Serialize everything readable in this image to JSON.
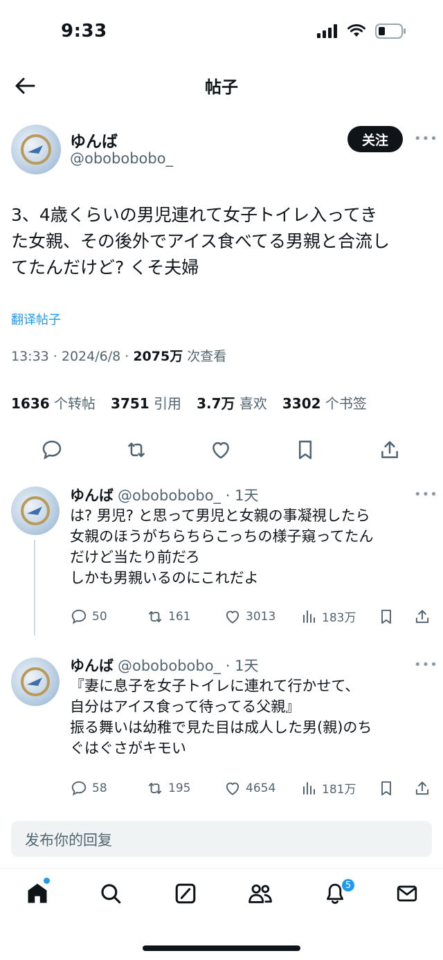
{
  "status_bar": {
    "time": "9:33"
  },
  "header": {
    "title": "帖子"
  },
  "post": {
    "author_name": "ゆんば",
    "author_handle": "@obobobobo_",
    "follow_label": "关注",
    "text_lines": [
      "3、4歳くらいの男児連れて女子トイレ入ってき",
      "た女親、その後外でアイス食べてる男親と合流し",
      "てたんだけど? くそ夫婦"
    ],
    "translate_label": "翻译帖子",
    "time": "13:33 · 2024/6/8 · ",
    "views_count": "2075万",
    "views_label": " 次查看",
    "stats": [
      {
        "count": "1636",
        "label": " 个转帖"
      },
      {
        "count": "3751",
        "label": " 引用"
      },
      {
        "count": "3.7万",
        "label": " 喜欢"
      },
      {
        "count": "3302",
        "label": " 个书签"
      }
    ]
  },
  "replies": [
    {
      "name": "ゆんば",
      "handle_time": "@obobobobo_ · 1天",
      "lines": [
        "は? 男児? と思って男児と女親の事凝視したら",
        "女親のほうがちらちらこっちの様子窺ってたん",
        "だけど当たり前だろ",
        "しかも男親いるのにこれだよ"
      ],
      "reply_count": "50",
      "retweet_count": "161",
      "like_count": "3013",
      "view_count": "183万"
    },
    {
      "name": "ゆんば",
      "handle_time": "@obobobobo_ · 1天",
      "lines": [
        "『妻に息子を女子トイレに連れて行かせて、",
        "自分はアイス食って待ってる父親』",
        "振る舞いは幼稚で見た目は成人した男(親)のち",
        "ぐはぐさがキモい"
      ],
      "reply_count": "58",
      "retweet_count": "195",
      "like_count": "4654",
      "view_count": "181万"
    }
  ],
  "reply_box": {
    "placeholder": "发布你的回复"
  },
  "tab_bar": {
    "notification_badge": "5"
  },
  "colors": {
    "accent": "#1d9bf0",
    "text": "#0f1419",
    "secondary": "#536471"
  }
}
